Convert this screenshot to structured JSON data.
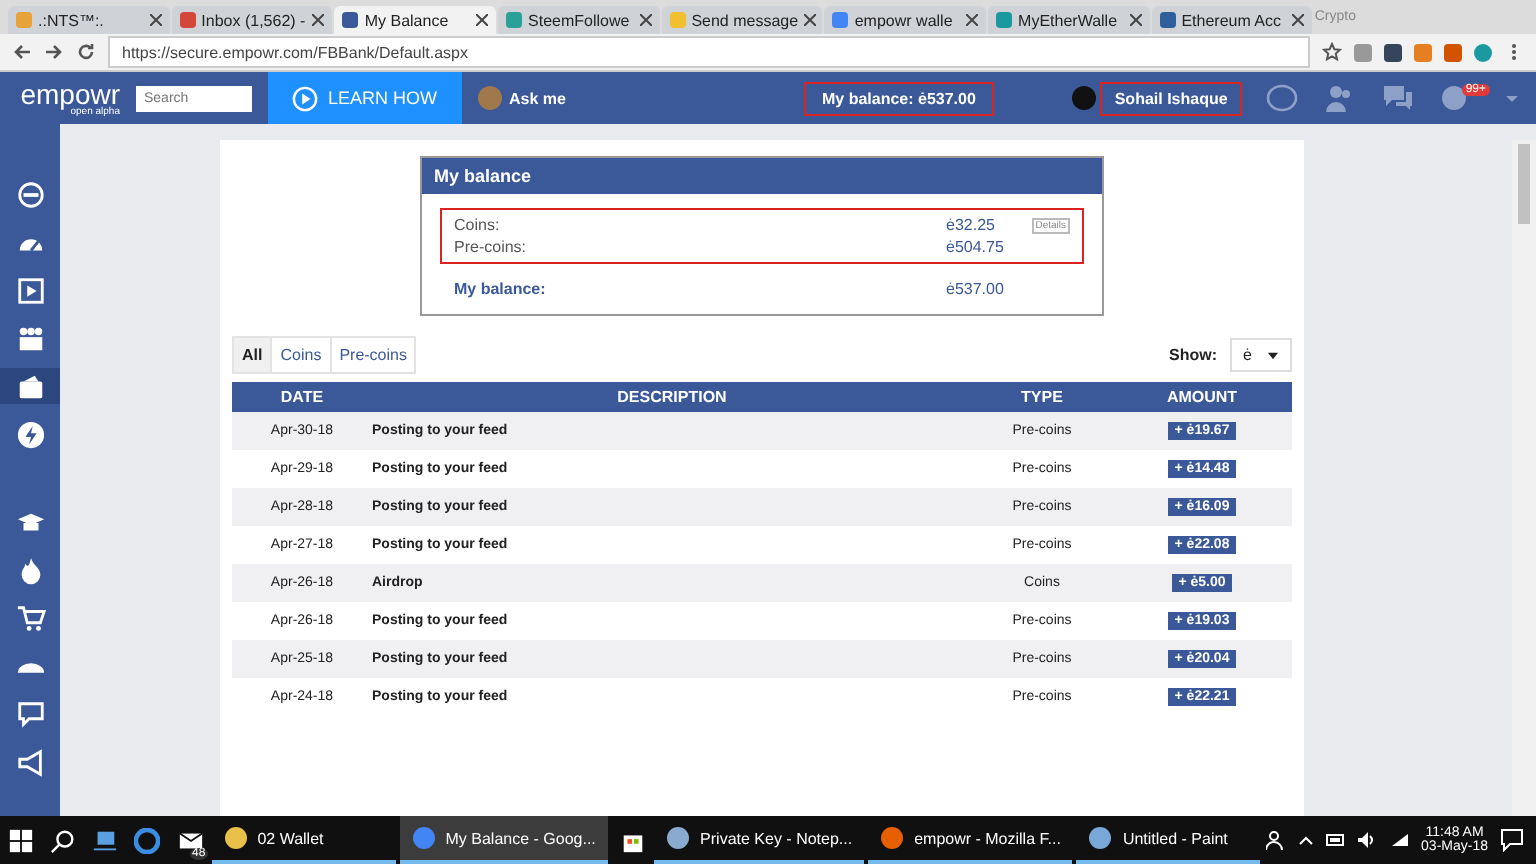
{
  "browser": {
    "tabs": [
      {
        "title": ".:NTS™:.",
        "selected": false
      },
      {
        "title": "Inbox (1,562) -",
        "selected": false
      },
      {
        "title": "My Balance",
        "selected": true
      },
      {
        "title": "SteemFollowe",
        "selected": false
      },
      {
        "title": "Send message",
        "selected": false
      },
      {
        "title": "empowr walle",
        "selected": false
      },
      {
        "title": "MyEtherWalle",
        "selected": false
      },
      {
        "title": "Ethereum Acc",
        "selected": false
      }
    ],
    "profile": "Crypto",
    "url": "https://secure.empowr.com/FBBank/Default.aspx"
  },
  "header": {
    "logo": "empowr",
    "logo_sub": "open alpha",
    "search": {
      "placeholder": "Search"
    },
    "learn_button": "LEARN HOW",
    "ask": "Ask me",
    "balance": {
      "text": "My balance: ė537.00",
      "highlighted": true
    },
    "user": {
      "name": "Sohail Ishaque",
      "highlighted": true
    },
    "notification_badge": "99+"
  },
  "sidebar": {
    "items": [
      {
        "selected": false
      },
      {
        "selected": false
      },
      {
        "selected": false
      },
      {
        "selected": false
      },
      {
        "selected": true
      },
      {
        "selected": false
      },
      {
        "selected": false
      },
      {
        "selected": false
      },
      {
        "selected": false
      },
      {
        "selected": false
      },
      {
        "selected": false
      },
      {
        "selected": false
      }
    ]
  },
  "balance_card": {
    "title": "My balance",
    "highlighted": true,
    "rows": [
      {
        "label": "Coins:",
        "value": "ė32.25",
        "details": "Details"
      },
      {
        "label": "Pre-coins:",
        "value": "ė504.75"
      }
    ],
    "total_label": "My balance:",
    "total_value": "ė537.00"
  },
  "filter_tabs": [
    {
      "label": "All",
      "selected": true
    },
    {
      "label": "Coins",
      "selected": false
    },
    {
      "label": "Pre-coins",
      "selected": false
    }
  ],
  "show": {
    "label": "Show:",
    "value": "ė"
  },
  "table": {
    "columns": [
      "DATE",
      "DESCRIPTION",
      "TYPE",
      "AMOUNT"
    ],
    "rows": [
      {
        "date": "Apr-30-18",
        "description": "Posting to your feed",
        "type": "Pre-coins",
        "amount": "+ ė19.67"
      },
      {
        "date": "Apr-29-18",
        "description": "Posting to your feed",
        "type": "Pre-coins",
        "amount": "+ ė14.48"
      },
      {
        "date": "Apr-28-18",
        "description": "Posting to your feed",
        "type": "Pre-coins",
        "amount": "+ ė16.09"
      },
      {
        "date": "Apr-27-18",
        "description": "Posting to your feed",
        "type": "Pre-coins",
        "amount": "+ ė22.08"
      },
      {
        "date": "Apr-26-18",
        "description": "Airdrop",
        "type": "Coins",
        "amount": "+ ė5.00"
      },
      {
        "date": "Apr-26-18",
        "description": "Posting to your feed",
        "type": "Pre-coins",
        "amount": "+ ė19.03"
      },
      {
        "date": "Apr-25-18",
        "description": "Posting to your feed",
        "type": "Pre-coins",
        "amount": "+ ė20.04"
      },
      {
        "date": "Apr-24-18",
        "description": "Posting to your feed",
        "type": "Pre-coins",
        "amount": "+ ė22.21"
      }
    ]
  },
  "taskbar": {
    "mail_badge": "48",
    "items": [
      {
        "label": "02 Wallet",
        "selected": false
      },
      {
        "label": "My Balance - Goog...",
        "selected": true
      },
      {
        "label": "Private Key - Notep...",
        "selected": false
      },
      {
        "label": "empowr - Mozilla F...",
        "selected": false
      },
      {
        "label": "Untitled - Paint",
        "selected": false
      }
    ],
    "time": "11:48 AM",
    "date": "03-May-18"
  }
}
